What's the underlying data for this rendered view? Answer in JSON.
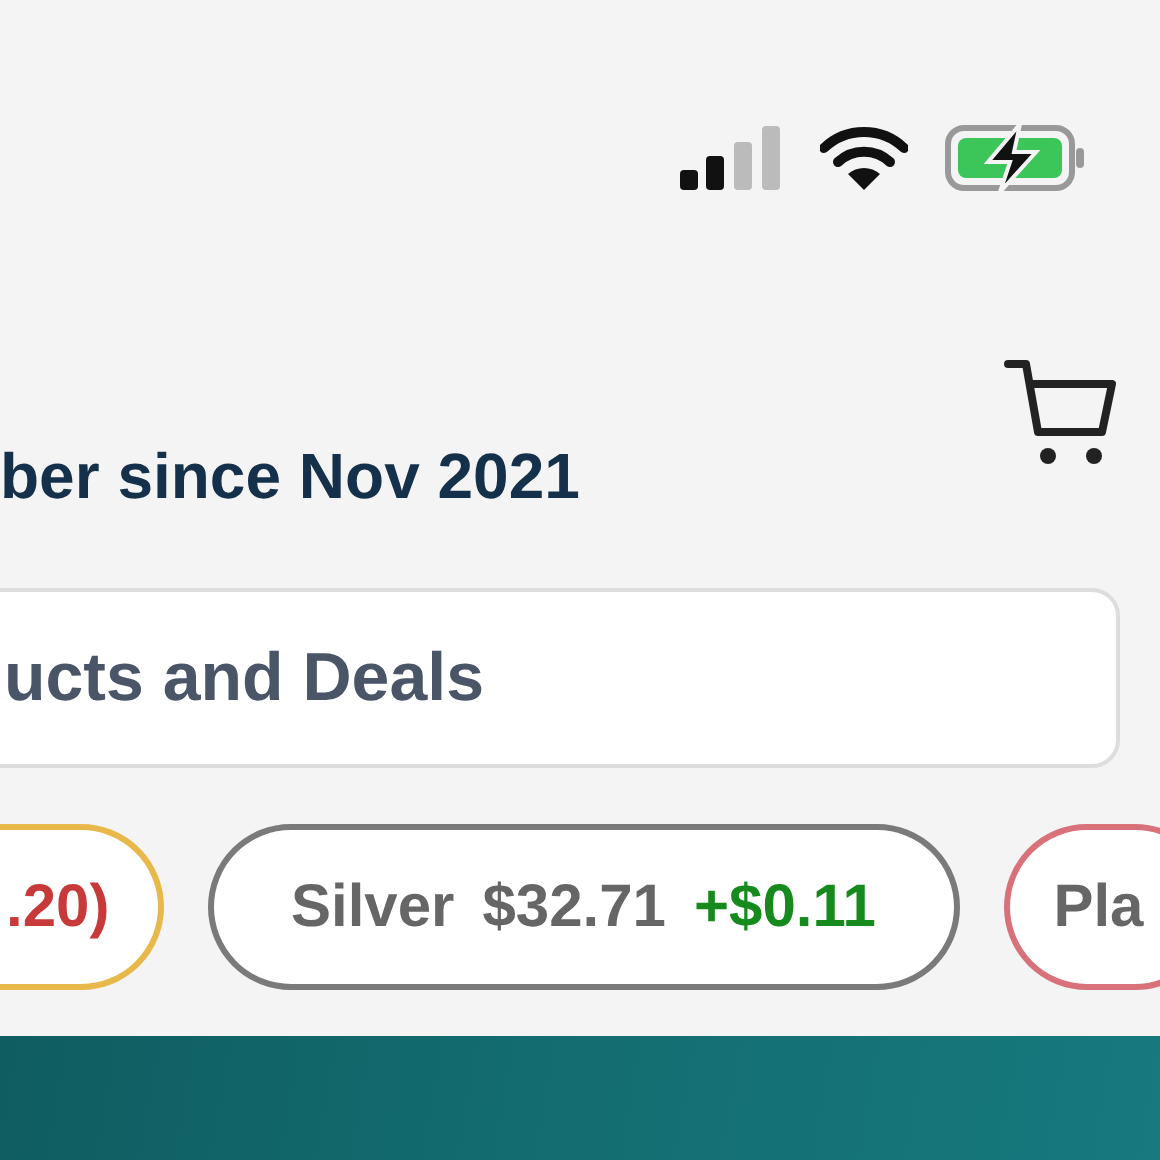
{
  "header": {
    "member_since": "ber since Nov 2021"
  },
  "search": {
    "placeholder": "ucts and Deals"
  },
  "tickers": [
    {
      "change": ".20)",
      "positive": false,
      "color": "#e8b84a"
    },
    {
      "label": "Silver",
      "price": "$32.71",
      "change": "+$0.11",
      "positive": true,
      "color": "#7a7a7a"
    },
    {
      "label": "Pla",
      "color": "#d9717a"
    }
  ]
}
